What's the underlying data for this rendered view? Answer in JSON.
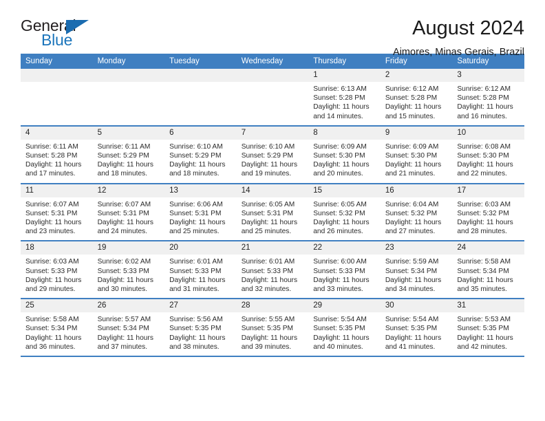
{
  "logo": {
    "word_top": "General",
    "word_bottom": "Blue",
    "triangle_color": "#1b6cb0",
    "blue_color": "#1b75bb"
  },
  "header": {
    "title": "August 2024",
    "subtitle": "Aimores, Minas Gerais, Brazil"
  },
  "theme": {
    "header_bg": "#3f7fc1",
    "daynum_bg": "#f0f0f0",
    "row_divider": "#3f7fc1"
  },
  "calendar": {
    "weekdays": [
      "Sunday",
      "Monday",
      "Tuesday",
      "Wednesday",
      "Thursday",
      "Friday",
      "Saturday"
    ],
    "labels": {
      "sunrise": "Sunrise:",
      "sunset": "Sunset:",
      "daylight": "Daylight:"
    },
    "weeks": [
      [
        {
          "day": "",
          "empty": true
        },
        {
          "day": "",
          "empty": true
        },
        {
          "day": "",
          "empty": true
        },
        {
          "day": "",
          "empty": true
        },
        {
          "day": "1",
          "sunrise": "Sunrise: 6:13 AM",
          "sunset": "Sunset: 5:28 PM",
          "daylight": "Daylight: 11 hours and 14 minutes."
        },
        {
          "day": "2",
          "sunrise": "Sunrise: 6:12 AM",
          "sunset": "Sunset: 5:28 PM",
          "daylight": "Daylight: 11 hours and 15 minutes."
        },
        {
          "day": "3",
          "sunrise": "Sunrise: 6:12 AM",
          "sunset": "Sunset: 5:28 PM",
          "daylight": "Daylight: 11 hours and 16 minutes."
        }
      ],
      [
        {
          "day": "4",
          "sunrise": "Sunrise: 6:11 AM",
          "sunset": "Sunset: 5:28 PM",
          "daylight": "Daylight: 11 hours and 17 minutes."
        },
        {
          "day": "5",
          "sunrise": "Sunrise: 6:11 AM",
          "sunset": "Sunset: 5:29 PM",
          "daylight": "Daylight: 11 hours and 18 minutes."
        },
        {
          "day": "6",
          "sunrise": "Sunrise: 6:10 AM",
          "sunset": "Sunset: 5:29 PM",
          "daylight": "Daylight: 11 hours and 18 minutes."
        },
        {
          "day": "7",
          "sunrise": "Sunrise: 6:10 AM",
          "sunset": "Sunset: 5:29 PM",
          "daylight": "Daylight: 11 hours and 19 minutes."
        },
        {
          "day": "8",
          "sunrise": "Sunrise: 6:09 AM",
          "sunset": "Sunset: 5:30 PM",
          "daylight": "Daylight: 11 hours and 20 minutes."
        },
        {
          "day": "9",
          "sunrise": "Sunrise: 6:09 AM",
          "sunset": "Sunset: 5:30 PM",
          "daylight": "Daylight: 11 hours and 21 minutes."
        },
        {
          "day": "10",
          "sunrise": "Sunrise: 6:08 AM",
          "sunset": "Sunset: 5:30 PM",
          "daylight": "Daylight: 11 hours and 22 minutes."
        }
      ],
      [
        {
          "day": "11",
          "sunrise": "Sunrise: 6:07 AM",
          "sunset": "Sunset: 5:31 PM",
          "daylight": "Daylight: 11 hours and 23 minutes."
        },
        {
          "day": "12",
          "sunrise": "Sunrise: 6:07 AM",
          "sunset": "Sunset: 5:31 PM",
          "daylight": "Daylight: 11 hours and 24 minutes."
        },
        {
          "day": "13",
          "sunrise": "Sunrise: 6:06 AM",
          "sunset": "Sunset: 5:31 PM",
          "daylight": "Daylight: 11 hours and 25 minutes."
        },
        {
          "day": "14",
          "sunrise": "Sunrise: 6:05 AM",
          "sunset": "Sunset: 5:31 PM",
          "daylight": "Daylight: 11 hours and 25 minutes."
        },
        {
          "day": "15",
          "sunrise": "Sunrise: 6:05 AM",
          "sunset": "Sunset: 5:32 PM",
          "daylight": "Daylight: 11 hours and 26 minutes."
        },
        {
          "day": "16",
          "sunrise": "Sunrise: 6:04 AM",
          "sunset": "Sunset: 5:32 PM",
          "daylight": "Daylight: 11 hours and 27 minutes."
        },
        {
          "day": "17",
          "sunrise": "Sunrise: 6:03 AM",
          "sunset": "Sunset: 5:32 PM",
          "daylight": "Daylight: 11 hours and 28 minutes."
        }
      ],
      [
        {
          "day": "18",
          "sunrise": "Sunrise: 6:03 AM",
          "sunset": "Sunset: 5:33 PM",
          "daylight": "Daylight: 11 hours and 29 minutes."
        },
        {
          "day": "19",
          "sunrise": "Sunrise: 6:02 AM",
          "sunset": "Sunset: 5:33 PM",
          "daylight": "Daylight: 11 hours and 30 minutes."
        },
        {
          "day": "20",
          "sunrise": "Sunrise: 6:01 AM",
          "sunset": "Sunset: 5:33 PM",
          "daylight": "Daylight: 11 hours and 31 minutes."
        },
        {
          "day": "21",
          "sunrise": "Sunrise: 6:01 AM",
          "sunset": "Sunset: 5:33 PM",
          "daylight": "Daylight: 11 hours and 32 minutes."
        },
        {
          "day": "22",
          "sunrise": "Sunrise: 6:00 AM",
          "sunset": "Sunset: 5:33 PM",
          "daylight": "Daylight: 11 hours and 33 minutes."
        },
        {
          "day": "23",
          "sunrise": "Sunrise: 5:59 AM",
          "sunset": "Sunset: 5:34 PM",
          "daylight": "Daylight: 11 hours and 34 minutes."
        },
        {
          "day": "24",
          "sunrise": "Sunrise: 5:58 AM",
          "sunset": "Sunset: 5:34 PM",
          "daylight": "Daylight: 11 hours and 35 minutes."
        }
      ],
      [
        {
          "day": "25",
          "sunrise": "Sunrise: 5:58 AM",
          "sunset": "Sunset: 5:34 PM",
          "daylight": "Daylight: 11 hours and 36 minutes."
        },
        {
          "day": "26",
          "sunrise": "Sunrise: 5:57 AM",
          "sunset": "Sunset: 5:34 PM",
          "daylight": "Daylight: 11 hours and 37 minutes."
        },
        {
          "day": "27",
          "sunrise": "Sunrise: 5:56 AM",
          "sunset": "Sunset: 5:35 PM",
          "daylight": "Daylight: 11 hours and 38 minutes."
        },
        {
          "day": "28",
          "sunrise": "Sunrise: 5:55 AM",
          "sunset": "Sunset: 5:35 PM",
          "daylight": "Daylight: 11 hours and 39 minutes."
        },
        {
          "day": "29",
          "sunrise": "Sunrise: 5:54 AM",
          "sunset": "Sunset: 5:35 PM",
          "daylight": "Daylight: 11 hours and 40 minutes."
        },
        {
          "day": "30",
          "sunrise": "Sunrise: 5:54 AM",
          "sunset": "Sunset: 5:35 PM",
          "daylight": "Daylight: 11 hours and 41 minutes."
        },
        {
          "day": "31",
          "sunrise": "Sunrise: 5:53 AM",
          "sunset": "Sunset: 5:35 PM",
          "daylight": "Daylight: 11 hours and 42 minutes."
        }
      ]
    ]
  }
}
